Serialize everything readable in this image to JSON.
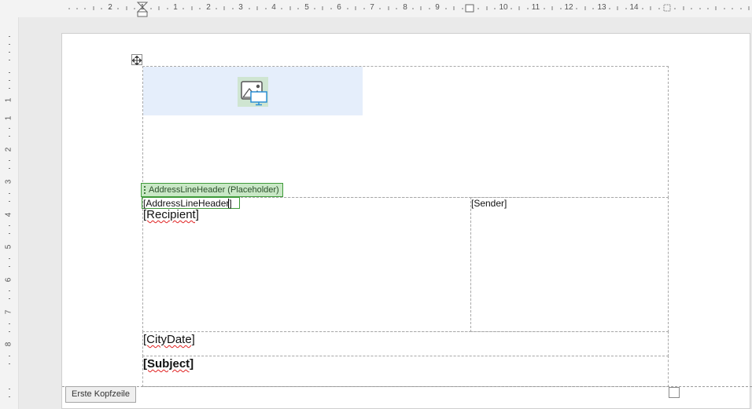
{
  "ruler": {
    "horizontal_labels": [
      "2",
      "1",
      "1",
      "2",
      "3",
      "4",
      "5",
      "6",
      "7",
      "8",
      "9",
      "10",
      "11",
      "12",
      "13",
      "14",
      "15"
    ],
    "vertical_labels": [
      "1",
      "1",
      "2",
      "3",
      "4",
      "5",
      "6",
      "7",
      "8"
    ]
  },
  "document": {
    "content_control_title": "AddressLineHeader (Placeholder)",
    "address_line_header": "[AddressLineHeader]",
    "recipient": "[Recipient]",
    "sender": "[Sender]",
    "city_date": "[CityDate]",
    "subject": "[Subject]",
    "header_label": "Erste Kopfzeile"
  },
  "icons": {
    "logo_placeholder": "picture-on-monitor-icon",
    "table_move": "move-arrows-icon",
    "table_resize": "resize-handle-icon"
  },
  "colors": {
    "logo_area": "#e5eefb",
    "content_control": "#c9e8c6",
    "spell_error": "#e02020"
  }
}
